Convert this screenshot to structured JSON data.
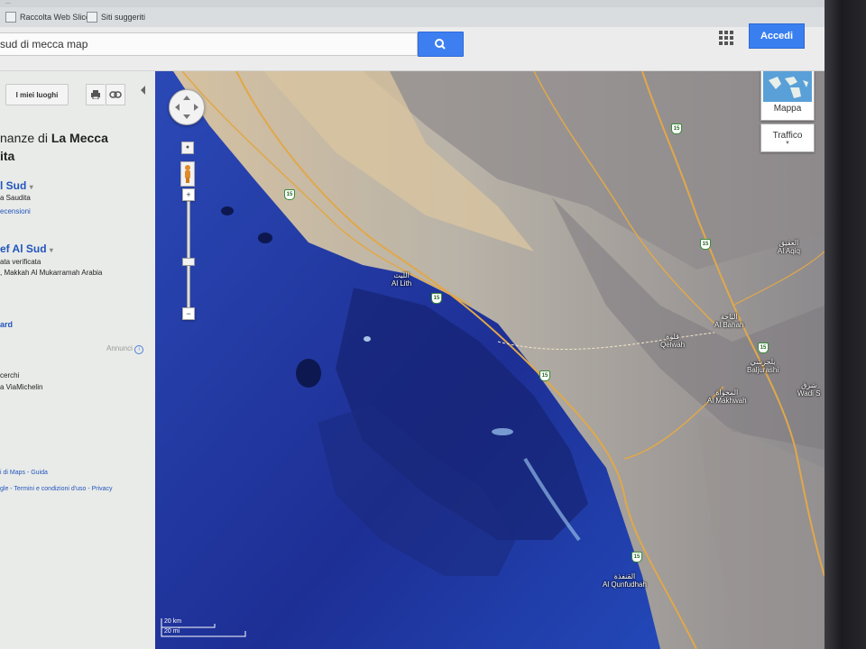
{
  "browser": {
    "top_caption": "...",
    "favorites": [
      {
        "label": "Raccolta Web Slice",
        "icon": "web-slice-icon"
      },
      {
        "label": "Siti suggeriti",
        "icon": "suggested-sites-icon"
      }
    ]
  },
  "header": {
    "search_value": "sud di mecca map",
    "search_icon": "search-icon",
    "apps_icon": "apps-grid-icon",
    "login_label": "Accedi",
    "accent_color": "#3a7ff0"
  },
  "left_panel": {
    "my_places_label": "I miei luoghi",
    "print_icon": "print-icon",
    "link_icon": "link-icon",
    "title_line1_prefix": "nanze di ",
    "title_line1_bold": "La Mecca",
    "title_line2": "ita",
    "result1_name": "l Sud",
    "result1_country": "a Saudita",
    "result1_reviews": "ecensioni",
    "result2_name": "ef Al Sud",
    "result2_verified": "ata verificata",
    "result2_address": ", Makkah Al Mukarramah Arabia",
    "link_ard": "ard",
    "ads_label": "Annunci",
    "info_icon": "info-icon",
    "cerchi": "cerchi",
    "viamichelin": "a ViaMichelin",
    "footer1": "i di Maps - Guida",
    "footer2": "gle - Termini e condizioni d'uso - Privacy"
  },
  "map": {
    "type_button": "Mappa",
    "traffic_button": "Traffico",
    "pan_icon": "pan-control-icon",
    "pegman_icon": "pegman-icon",
    "zoom_in": "+",
    "zoom_out": "−",
    "scale_km": "20 km",
    "scale_mi": "20 mi",
    "route_number": "15",
    "places": [
      {
        "ar": "الليث",
        "en": "Al Lith"
      },
      {
        "ar": "قلوة",
        "en": "Qelwah"
      },
      {
        "ar": "الباحة",
        "en": "Al Bahah"
      },
      {
        "ar": "بلجرشي",
        "en": "Baljurashi"
      },
      {
        "ar": "المخواة",
        "en": "Al Makhwah"
      },
      {
        "ar": "القنفذة",
        "en": "Al Qunfudhah"
      },
      {
        "ar": "العقيق",
        "en": "Al Aqiq"
      },
      {
        "ar": "شرق",
        "en": "Wadi S"
      }
    ]
  }
}
